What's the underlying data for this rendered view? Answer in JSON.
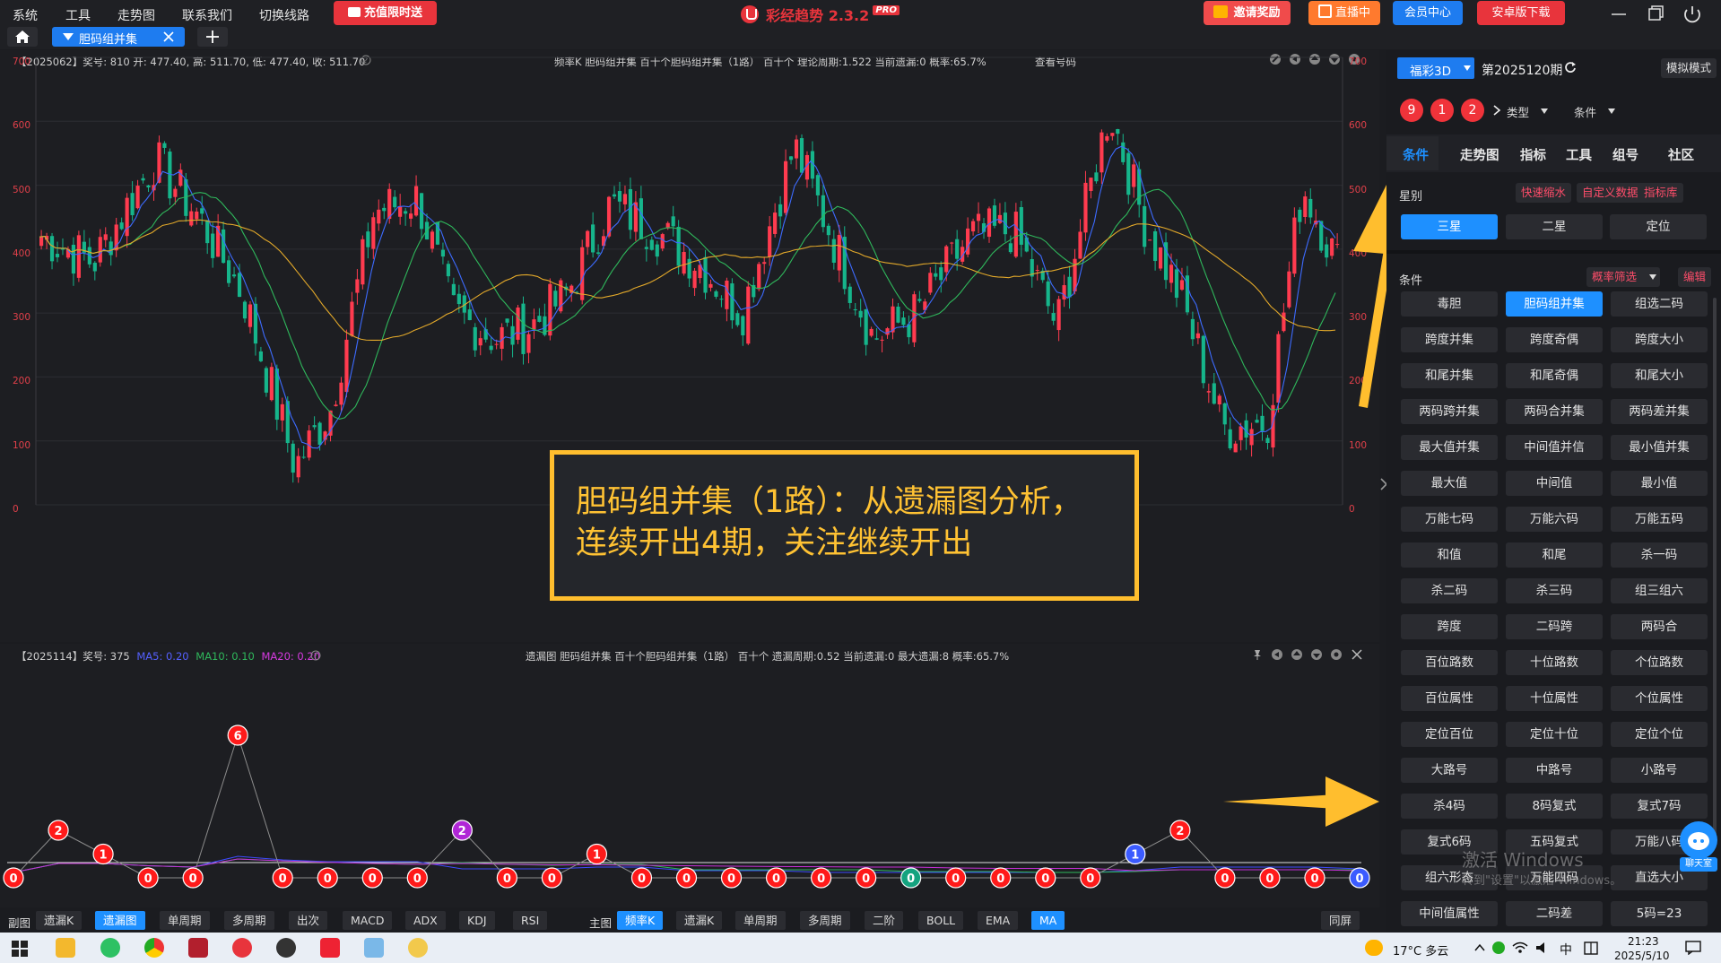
{
  "menu": {
    "items": [
      "系统",
      "工具",
      "走势图",
      "联系我们",
      "切换线路"
    ],
    "recharge": "充值限时送"
  },
  "app": {
    "title": "彩经趋势 2.3.2",
    "badge": "PRO"
  },
  "top_buttons": [
    "邀请奖励",
    "直播中",
    "会员中心",
    "安卓版下载"
  ],
  "tab": {
    "label": "胆码组并集"
  },
  "main_info": {
    "left": "【2025062】奖号: 810  开: 477.40, 高: 511.70, 低: 477.40, 收: 511.70",
    "center": "频率K  胆码组并集  百十个胆码组并集（1路）  百十个  理论周期:1.522  当前遗漏:0  概率:65.7%",
    "link": "查看号码"
  },
  "y_ticks": [
    "700",
    "600",
    "500",
    "400",
    "300",
    "200",
    "100",
    "0"
  ],
  "annotation": {
    "line1": "胆码组并集（1路）：从遗漏图分析，",
    "line2": "连续开出4期，关注继续开出"
  },
  "sub_info": {
    "left": "【2025114】奖号: 375",
    "ma5": "MA5: 0.20",
    "ma10": "MA10: 0.10",
    "ma20": "MA20: 0.20",
    "center": "遗漏图  胆码组并集  百十个胆码组并集（1路）  百十个  遗漏周期:0.52  当前遗漏:0  最大遗漏:8  概率:65.7%"
  },
  "omission": {
    "values": [
      0,
      2,
      1,
      0,
      0,
      6,
      0,
      0,
      0,
      0,
      2,
      0,
      0,
      1,
      0,
      0,
      0,
      0,
      0,
      0,
      0,
      0,
      0,
      0,
      0,
      1,
      2,
      0,
      0,
      0,
      0
    ],
    "colors": {
      "zero": "#ff1a1a",
      "hit": "#ff1a1a",
      "purple": "#b026d6",
      "teal": "#14a37f",
      "blue": "#3b5bff"
    }
  },
  "bottom_left": {
    "label": "副图",
    "buttons": [
      "遗漏K",
      "遗漏图",
      "单周期",
      "多周期",
      "出次",
      "MACD",
      "ADX",
      "KDJ",
      "RSI"
    ],
    "active": "遗漏图"
  },
  "bottom_right": {
    "label": "主图",
    "buttons": [
      "频率K",
      "遗漏K",
      "单周期",
      "多周期",
      "二阶",
      "BOLL",
      "EMA",
      "MA"
    ],
    "active": [
      "频率K",
      "MA"
    ],
    "same_screen": "同屏"
  },
  "right": {
    "lottery": "福彩3D",
    "period": "第2025120期",
    "mode": "模拟模式",
    "balls": [
      "9",
      "1",
      "2"
    ],
    "type_select": "类型",
    "cond_select": "条件",
    "nav": [
      "条件",
      "走势图",
      "指标",
      "工具",
      "组号",
      "社区"
    ],
    "category_label": "星别",
    "chips": [
      "快速缩水",
      "自定义数据",
      "指标库"
    ],
    "stars": [
      "三星",
      "二星",
      "定位"
    ],
    "cond_label": "条件",
    "filter": "概率筛选",
    "edit": "编辑",
    "grid": [
      [
        "毒胆",
        "胆码组并集",
        "组选二码"
      ],
      [
        "跨度并集",
        "跨度奇偶",
        "跨度大小"
      ],
      [
        "和尾并集",
        "和尾奇偶",
        "和尾大小"
      ],
      [
        "两码跨并集",
        "两码合并集",
        "两码差并集"
      ],
      [
        "最大值并集",
        "中间值并信",
        "最小值并集"
      ],
      [
        "最大值",
        "中间值",
        "最小值"
      ],
      [
        "万能七码",
        "万能六码",
        "万能五码"
      ],
      [
        "和值",
        "和尾",
        "杀一码"
      ],
      [
        "杀二码",
        "杀三码",
        "组三组六"
      ],
      [
        "跨度",
        "二码跨",
        "两码合"
      ],
      [
        "百位路数",
        "十位路数",
        "个位路数"
      ],
      [
        "百位属性",
        "十位属性",
        "个位属性"
      ],
      [
        "定位百位",
        "定位十位",
        "定位个位"
      ],
      [
        "大路号",
        "中路号",
        "小路号"
      ],
      [
        "杀4码",
        "8码复式",
        "复式7码"
      ],
      [
        "复式6码",
        "五码复式",
        "万能八码"
      ],
      [
        "组六形态",
        "万能四码",
        "直选大小"
      ],
      [
        "中间值属性",
        "二码差",
        "5码=23"
      ]
    ],
    "active_cond": "胆码组并集",
    "watermark1": "激活 Windows",
    "watermark2": "转到\"设置\"以激活 Windows。",
    "chat": "聊天室"
  },
  "taskbar": {
    "weather": "17°C 多云",
    "ime": "中",
    "time": "21:23",
    "date": "2025/5/10"
  }
}
